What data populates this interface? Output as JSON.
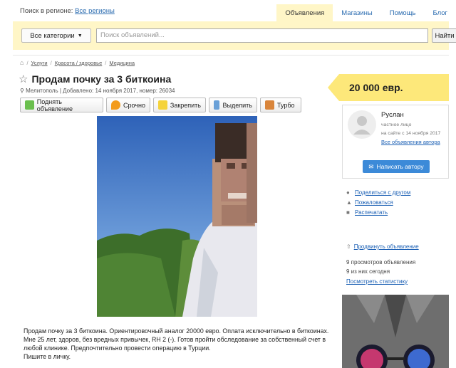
{
  "header": {
    "region_label": "Поиск в регионе:",
    "region_link": "Все регионы",
    "nav": [
      "Объявления",
      "Магазины",
      "Помощь",
      "Блог"
    ]
  },
  "search": {
    "category_label": "Все категории",
    "placeholder": "Поиск объявлений...",
    "button": "Найти"
  },
  "breadcrumbs": [
    "Услуги",
    "Красота / здоровье",
    "Медицина"
  ],
  "listing": {
    "title": "Продам почку за 3 биткоина",
    "meta": "Мелитополь | Добавлено: 14 ноября 2017, номер: 26034",
    "actions": [
      "Поднять объявление",
      "Срочно",
      "Закрепить",
      "Выделить",
      "Турбо"
    ],
    "description_lines": [
      "Продам почку за 3 биткоина. Ориентировочный аналог 20000 евро. Оплата исключительно в биткоинах.",
      "Мне 25 лет, здоров, без вредных привычек, RH 2 (-). Готов пройти обследование за собственный счет в",
      "любой клинике. Предпочтительно провести операцию в Турции.",
      "Пишите в личку."
    ]
  },
  "price": "20 000 евр.",
  "seller": {
    "name": "Руслан",
    "type": "частное лицо",
    "since": "на сайте с 14 ноября 2017",
    "all_link": "Все объявления автора",
    "write_button": "Написать автору"
  },
  "sidebar_links": [
    "Поделиться с другом",
    "Пожаловаться",
    "Распечатать"
  ],
  "promote_link": "Продвинуть объявление",
  "stats": {
    "views": "9 просмотров объявления",
    "today": "9 из них сегодня",
    "link": "Посмотреть статистику"
  },
  "colors": {
    "accent_yellow": "#fff6c7",
    "price_yellow": "#fde87a",
    "button_blue": "#3c8ad8"
  }
}
